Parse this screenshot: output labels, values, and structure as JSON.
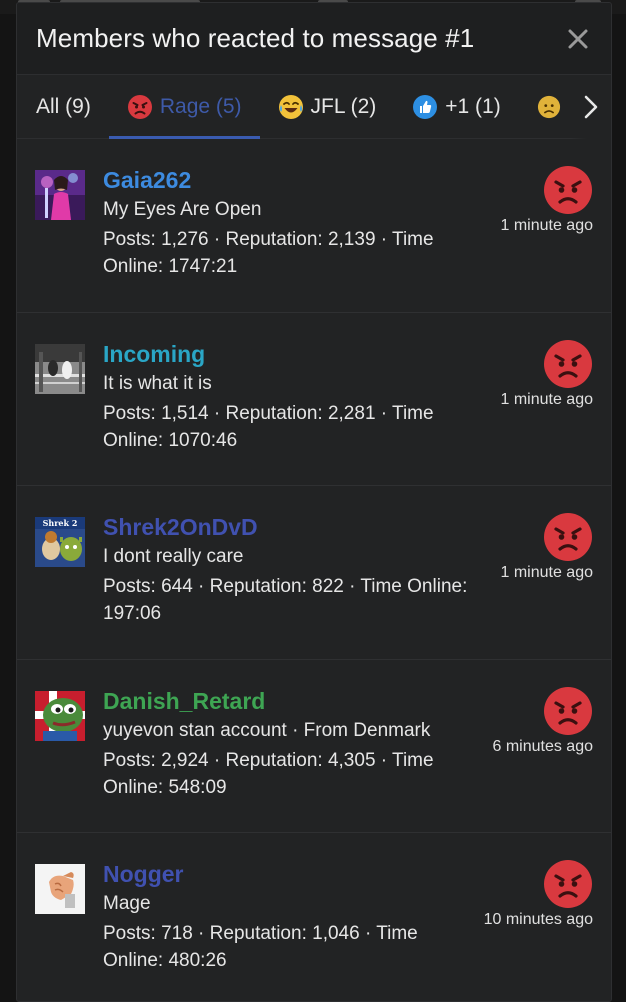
{
  "dialog": {
    "title": "Members who reacted to message #1"
  },
  "tabs": [
    {
      "label": "All (9)",
      "icon": "none"
    },
    {
      "label": "Rage (5)",
      "icon": "angry-face-icon"
    },
    {
      "label": "JFL (2)",
      "icon": "laughing-crying-face-icon"
    },
    {
      "label": "+1 (1)",
      "icon": "thumbs-up-icon"
    },
    {
      "label": "",
      "icon": "sad-face-icon"
    }
  ],
  "active_tab": "Rage (5)",
  "members": [
    {
      "username": "Gaia262",
      "username_color": "#3d8be0",
      "tagline": "My Eyes Are Open",
      "stats": "Posts: 1,276 · Reputation: 2,139 · Time Online: 1747:21",
      "time": "1 minute ago",
      "reaction_icon": "angry-face-icon"
    },
    {
      "username": "Incoming",
      "username_color": "#2aa6c6",
      "tagline": "It is what it is",
      "stats": "Posts: 1,514 · Reputation: 2,281 · Time Online: 1070:46",
      "time": "1 minute ago",
      "reaction_icon": "angry-face-icon"
    },
    {
      "username": "Shrek2OnDvD",
      "username_color": "#4051b0",
      "tagline": "I dont really care",
      "stats": "Posts: 644 · Reputation: 822 · Time Online: 197:06",
      "time": "1 minute ago",
      "reaction_icon": "angry-face-icon"
    },
    {
      "username": "Danish_Retard",
      "username_color": "#3ea553",
      "tagline": "yuyevon stan account · From Denmark",
      "stats": "Posts: 2,924 · Reputation: 4,305 · Time Online: 548:09",
      "time": "6 minutes ago",
      "reaction_icon": "angry-face-icon"
    },
    {
      "username": "Nogger",
      "username_color": "#4051b0",
      "tagline": "Mage",
      "stats": "Posts: 718 · Reputation: 1,046 · Time Online: 480:26",
      "time": "10 minutes ago",
      "reaction_icon": "angry-face-icon"
    }
  ],
  "colors": {
    "accent": "#3a5bb0",
    "rage_red": "#d9393f",
    "background": "#222324"
  }
}
